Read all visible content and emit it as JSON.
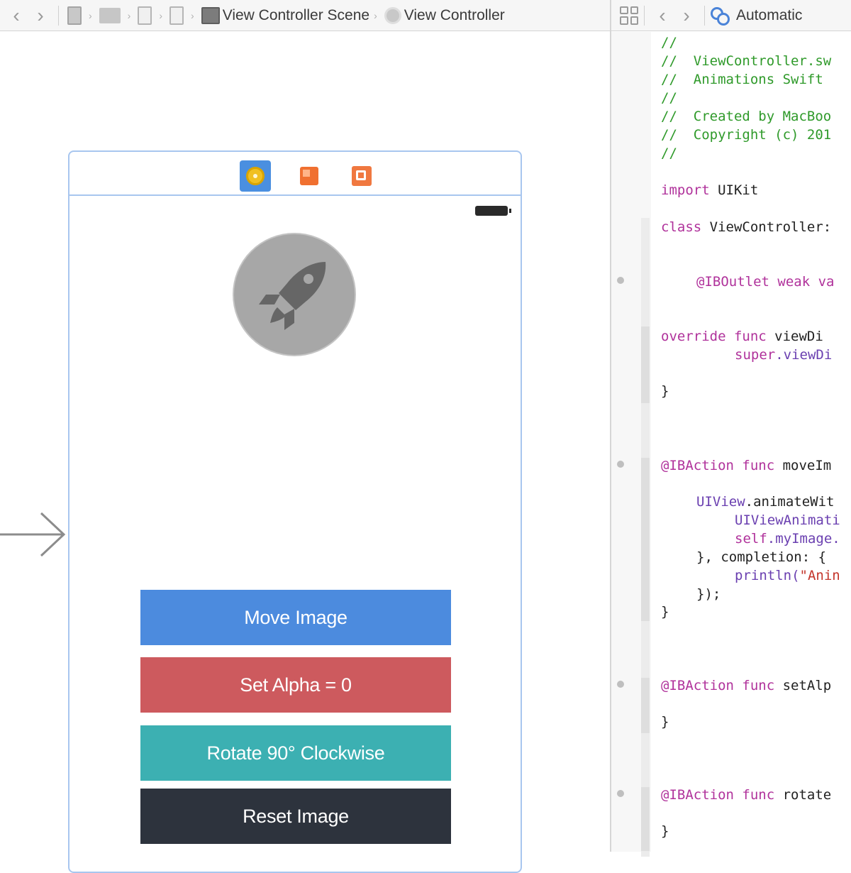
{
  "toolbar": {
    "breadcrumb_scene": "View Controller Scene",
    "breadcrumb_vc": "View Controller",
    "assistant_mode": "Automatic"
  },
  "scene": {
    "buttons": {
      "move": "Move Image",
      "alpha": "Set Alpha = 0",
      "rotate": "Rotate 90° Clockwise",
      "reset": "Reset Image"
    }
  },
  "code": {
    "lines": [
      "//",
      "//  ViewController.sw",
      "//  Animations Swift",
      "//",
      "//  Created by MacBoo",
      "//  Copyright (c) 201",
      "//",
      "import",
      " UIKit",
      "class",
      " ViewController:",
      "@IBOutlet weak va",
      "override func",
      " viewDi",
      "super",
      ".viewDi",
      "}",
      "@IBAction func",
      " moveIm",
      "UIView",
      ".animateWit",
      "UIViewAnimati",
      "self",
      ".myImage.",
      "}, completion: {",
      "println(",
      "\"Anin",
      "});",
      "}",
      "@IBAction func",
      " setAlp",
      "}",
      "@IBAction func",
      " rotate",
      "}"
    ]
  },
  "colors": {
    "move_button": "#4c8bde",
    "alpha_button": "#cd5a5e",
    "rotate_button": "#3cb0b2",
    "reset_button": "#2d333d",
    "scene_outline": "#a8c6ef",
    "comment": "#2f9a2a",
    "keyword": "#b0329b"
  },
  "icons": {
    "entry_point": "arrow-right-icon",
    "image_view": "rocket-icon",
    "dock": [
      "view-controller-icon",
      "first-responder-icon",
      "exit-icon"
    ]
  }
}
